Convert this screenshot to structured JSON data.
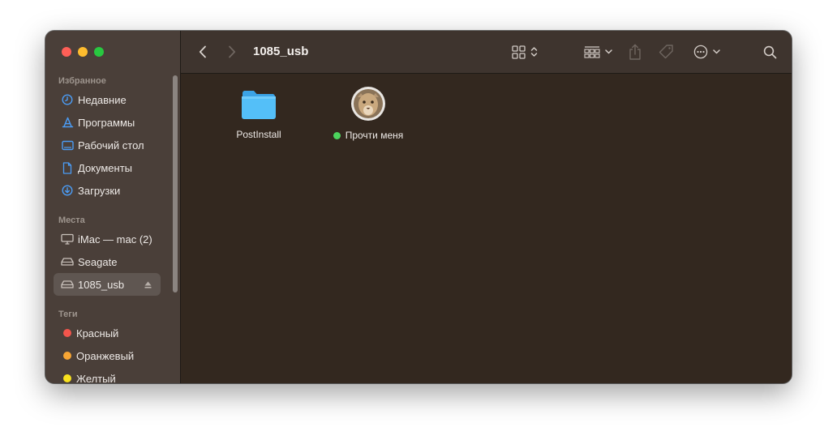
{
  "window": {
    "title": "1085_usb",
    "accent": "#3b82f6"
  },
  "sidebar": {
    "favorites_label": "Избранное",
    "favorites": [
      {
        "label": "Недавние",
        "icon": "clock-icon"
      },
      {
        "label": "Программы",
        "icon": "apps-icon"
      },
      {
        "label": "Рабочий стол",
        "icon": "desktop-icon"
      },
      {
        "label": "Документы",
        "icon": "document-icon"
      },
      {
        "label": "Загрузки",
        "icon": "download-icon"
      }
    ],
    "places_label": "Места",
    "places": [
      {
        "label": "iMac — mac (2)",
        "icon": "computer-icon"
      },
      {
        "label": "Seagate",
        "icon": "drive-icon"
      },
      {
        "label": "1085_usb",
        "icon": "drive-icon",
        "selected": true
      }
    ],
    "tags_label": "Теги",
    "tags": [
      {
        "label": "Красный",
        "color": "#f2554c"
      },
      {
        "label": "Оранжевый",
        "color": "#f7a534"
      },
      {
        "label": "Желтый",
        "color": "#f8e11e"
      }
    ]
  },
  "files": [
    {
      "name": "PostInstall",
      "icon": "folder-icon"
    },
    {
      "name": "Прочти меня",
      "icon": "mountain-lion-icon",
      "tag_color": "#4cd35d"
    }
  ]
}
